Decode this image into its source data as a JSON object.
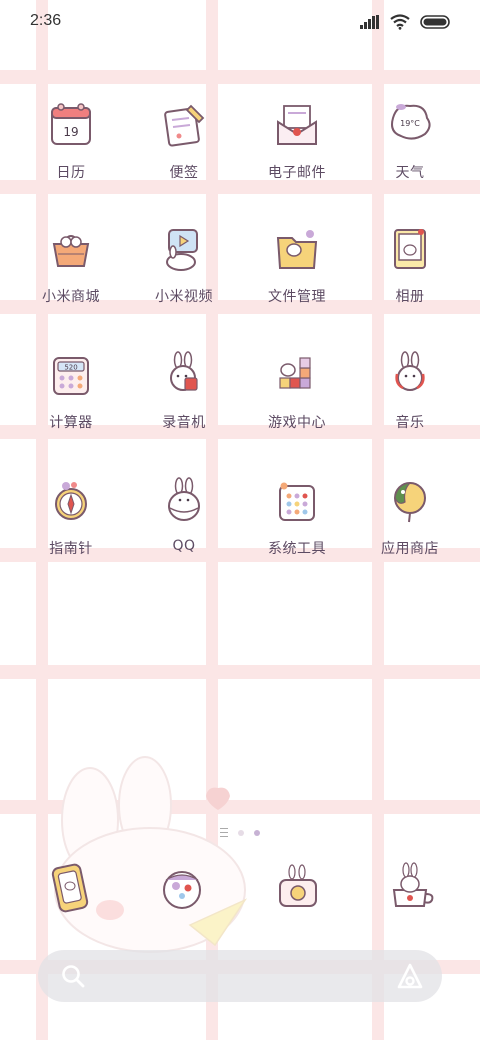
{
  "status_bar": {
    "time": "2:36",
    "icons": [
      "signal-icon",
      "wifi-icon",
      "battery-icon"
    ]
  },
  "apps": [
    {
      "label": "日历",
      "icon": "calendar-icon",
      "day": "19"
    },
    {
      "label": "便签",
      "icon": "notes-icon"
    },
    {
      "label": "电子邮件",
      "icon": "email-icon"
    },
    {
      "label": "天气",
      "icon": "weather-icon",
      "temp": "19°C"
    },
    {
      "label": "小米商城",
      "icon": "mi-store-icon"
    },
    {
      "label": "小米视频",
      "icon": "mi-video-icon"
    },
    {
      "label": "文件管理",
      "icon": "file-manager-icon"
    },
    {
      "label": "相册",
      "icon": "gallery-icon"
    },
    {
      "label": "计算器",
      "icon": "calculator-icon",
      "display": "520"
    },
    {
      "label": "录音机",
      "icon": "recorder-icon"
    },
    {
      "label": "游戏中心",
      "icon": "game-center-icon"
    },
    {
      "label": "音乐",
      "icon": "music-icon"
    },
    {
      "label": "指南针",
      "icon": "compass-icon"
    },
    {
      "label": "QQ",
      "icon": "qq-icon"
    },
    {
      "label": "系统工具",
      "icon": "system-tools-icon"
    },
    {
      "label": "应用商店",
      "icon": "app-store-icon"
    }
  ],
  "page_indicator": {
    "pages": 3,
    "active": 3
  },
  "dock": [
    {
      "icon": "phone-icon"
    },
    {
      "icon": "messages-icon"
    },
    {
      "icon": "camera-icon"
    },
    {
      "icon": "browser-icon"
    }
  ],
  "search_bar": {
    "left_icon": "search-icon",
    "right_icon": "assistant-icon"
  },
  "colors": {
    "label": "#5d4b63",
    "grid": "#fbe6e6",
    "accent": "#c7b2d4"
  }
}
